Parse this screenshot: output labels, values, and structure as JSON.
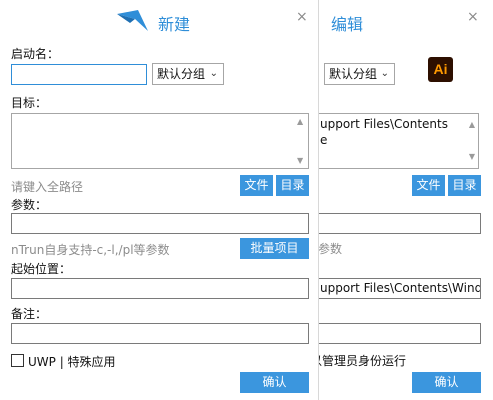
{
  "front": {
    "title": "新建",
    "close_glyph": "×",
    "name_label": "启动名：",
    "name_value": "",
    "group_select": "默认分组",
    "target_label": "目标：",
    "target_value": "",
    "target_placeholder": "请键入全路径",
    "file_button": "文件",
    "dir_button": "目录",
    "params_label": "参数：",
    "params_value": "",
    "params_hint": "nTrun自身支持-c,-l,/pl等参数",
    "batch_button": "批量项目",
    "start_label": "起始位置：",
    "start_value": "",
    "note_label": "备注：",
    "note_value": "",
    "uwp_label": "UWP | 特殊应用",
    "confirm_button": "确认"
  },
  "back": {
    "title": "编辑",
    "close_glyph": "×",
    "group_select": "默认分组",
    "app_icon_text": "Ai",
    "target_value_line1": "upport Files\\Contents",
    "target_value_line2": "e",
    "file_button": "文件",
    "dir_button": "目录",
    "params_hint_fragment": "参数",
    "start_value": "upport Files\\Contents\\Windo",
    "admin_label_fragment": "以管理员身份运行",
    "confirm_button": "确认"
  }
}
